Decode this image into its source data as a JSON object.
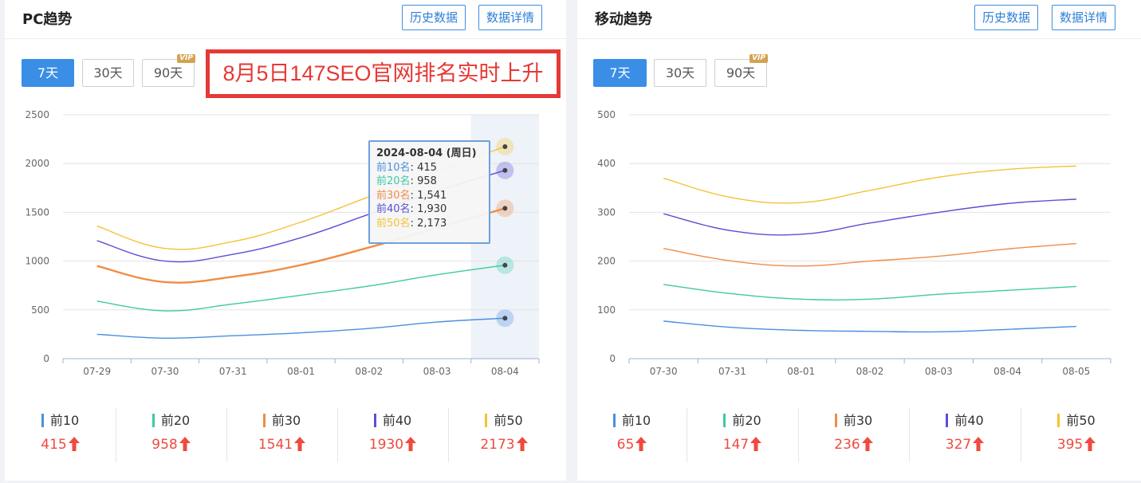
{
  "panels": [
    {
      "title": "PC趋势",
      "history_btn": "历史数据",
      "detail_btn": "数据详情",
      "ranges": [
        "7天",
        "30天",
        "90天"
      ],
      "vip_badge": "VIP",
      "banner": "8月5日147SEO官网排名实时上升",
      "tooltip": {
        "date": "2024-08-04 (周日)",
        "rows": [
          {
            "name": "前10名",
            "value": "415"
          },
          {
            "name": "前20名",
            "value": "958"
          },
          {
            "name": "前30名",
            "value": "1,541"
          },
          {
            "name": "前40名",
            "value": "1,930"
          },
          {
            "name": "前50名",
            "value": "2,173"
          }
        ]
      },
      "stats": [
        {
          "label": "前10",
          "value": "415"
        },
        {
          "label": "前20",
          "value": "958"
        },
        {
          "label": "前30",
          "value": "1541"
        },
        {
          "label": "前40",
          "value": "1930"
        },
        {
          "label": "前50",
          "value": "2173"
        }
      ]
    },
    {
      "title": "移动趋势",
      "history_btn": "历史数据",
      "detail_btn": "数据详情",
      "ranges": [
        "7天",
        "30天",
        "90天"
      ],
      "vip_badge": "VIP",
      "stats": [
        {
          "label": "前10",
          "value": "65"
        },
        {
          "label": "前20",
          "value": "147"
        },
        {
          "label": "前30",
          "value": "236"
        },
        {
          "label": "前40",
          "value": "327"
        },
        {
          "label": "前50",
          "value": "395"
        }
      ]
    }
  ],
  "colors": {
    "前10": "#4a8fe0",
    "前20": "#3dcaa5",
    "前30": "#f08c45",
    "前40": "#5a4fd4",
    "前50": "#f4c236",
    "up_arrow": "#f04a3e",
    "accent": "#3a8ee6"
  },
  "chart_data": [
    {
      "type": "line",
      "x": [
        "07-29",
        "07-30",
        "07-31",
        "08-01",
        "08-02",
        "08-03",
        "08-04"
      ],
      "ylim": [
        0,
        2500
      ],
      "yticks": [
        0,
        500,
        1000,
        1500,
        2000,
        2500
      ],
      "grid": true,
      "highlight_x": "08-04",
      "series": [
        {
          "name": "前10",
          "values": [
            250,
            210,
            235,
            265,
            310,
            375,
            415
          ]
        },
        {
          "name": "前20",
          "values": [
            590,
            490,
            560,
            650,
            745,
            860,
            958
          ]
        },
        {
          "name": "前30",
          "values": [
            950,
            785,
            840,
            960,
            1140,
            1340,
            1541
          ]
        },
        {
          "name": "前40",
          "values": [
            1210,
            1000,
            1070,
            1240,
            1480,
            1720,
            1930
          ]
        },
        {
          "name": "前50",
          "values": [
            1360,
            1130,
            1200,
            1400,
            1660,
            1920,
            2173
          ]
        }
      ]
    },
    {
      "type": "line",
      "x": [
        "07-30",
        "07-31",
        "08-01",
        "08-02",
        "08-03",
        "08-04",
        "08-05"
      ],
      "ylim": [
        0,
        500
      ],
      "yticks": [
        0,
        100,
        200,
        300,
        400,
        500
      ],
      "grid": true,
      "series": [
        {
          "name": "前10",
          "values": [
            77,
            64,
            58,
            56,
            55,
            60,
            66
          ]
        },
        {
          "name": "前20",
          "values": [
            152,
            133,
            122,
            122,
            132,
            140,
            148
          ]
        },
        {
          "name": "前30",
          "values": [
            226,
            200,
            190,
            200,
            210,
            225,
            236
          ]
        },
        {
          "name": "前40",
          "values": [
            297,
            262,
            255,
            278,
            300,
            318,
            327
          ]
        },
        {
          "name": "前50",
          "values": [
            370,
            330,
            320,
            345,
            372,
            388,
            395
          ]
        }
      ]
    }
  ]
}
